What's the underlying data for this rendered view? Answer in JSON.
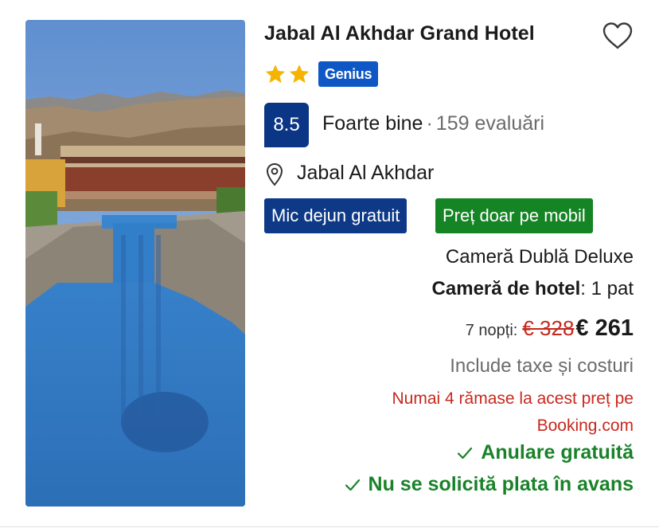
{
  "hotel": {
    "name": "Jabal Al Akhdar Grand Hotel",
    "stars": 2,
    "genius_label": "Genius",
    "score": "8.5",
    "score_word": "Foarte bine",
    "separator": "·",
    "reviews": "159 evaluări",
    "location": "Jabal Al Akhdar"
  },
  "badges": {
    "breakfast": "Mic dejun gratuit",
    "mobile_price": "Preț doar pe mobil"
  },
  "room": {
    "type": "Cameră Dublă Deluxe",
    "bed_label": "Cameră de hotel",
    "bed_value": ": 1 pat"
  },
  "price": {
    "nights": "7 nopți:",
    "old": "€ 328",
    "new": "€ 261",
    "taxes": "Include taxe și costuri",
    "urgency": "Numai 4 rămase la acest preț pe Booking.com"
  },
  "perks": {
    "cancel": "Anulare gratuită",
    "no_prepay": "Nu se solicită plata în avans"
  },
  "icons": {
    "favorite": "heart-outline-icon",
    "star": "star-icon",
    "location": "map-pin-icon",
    "check": "check-icon"
  },
  "colors": {
    "genius": "#0e57c5",
    "score": "#0b3585",
    "badge_blue": "#0e3987",
    "badge_green": "#158425",
    "star": "#f5b400",
    "urgency": "#c8281e",
    "perk": "#198229"
  }
}
